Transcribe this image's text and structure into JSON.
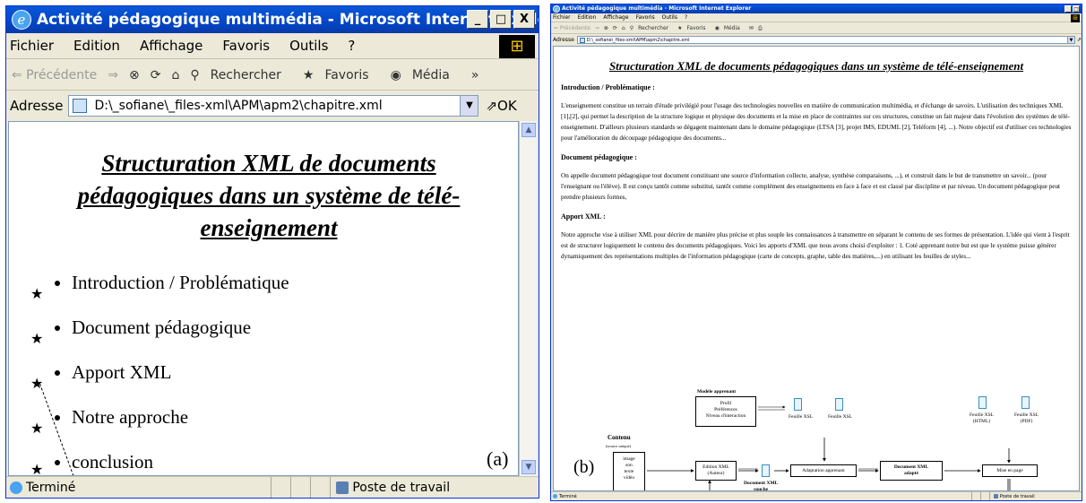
{
  "window": {
    "title": "Activité pédagogique multimédia - Microsoft Internet Explorer",
    "min": "_",
    "max": "□",
    "close": "X"
  },
  "menu": [
    "Fichier",
    "Edition",
    "Affichage",
    "Favoris",
    "Outils",
    "?"
  ],
  "toolbar": {
    "back": "⇐ Précédente",
    "forward": "⇒",
    "search": "Rechercher",
    "favorites": "Favoris",
    "media": "Média",
    "more": "»"
  },
  "address": {
    "label": "Adresse",
    "value_a": "D:\\_sofiane\\_files-xml\\APM\\apm2\\chapitre.xml",
    "value_b": "D:\\_sofiane\\_files-xml\\APM\\apm2\\chapitre.xml",
    "go": "OK"
  },
  "status": {
    "done": "Terminé",
    "zone": "Poste de travail"
  },
  "docA": {
    "title": "Structuration XML de documents pédagogiques dans un système de télé-enseignement",
    "items": [
      "Introduction / Problématique",
      "Document pédagogique",
      "Apport XML",
      "Notre approche",
      "conclusion"
    ],
    "label": "(a)"
  },
  "docB": {
    "title": "Structuration XML de documents pédagogiques dans un système de télé-enseignement",
    "h1": "Introduction / Problématique :",
    "p1": "L'enseignement constitue un terrain d'étude privilégié pour l'usage des technologies nouvelles en matière de communication multimédia, et d'échange de savoirs. L'utilisation des techniques XML [1],[2], qui permet la description de la structure logique et physique des documents et la mise en place de contraintes sur ces structures, constitue un fait majeur dans l'évolution des systèmes de télé-enseignement. D'ailleurs plusieurs standards se dégagent maintenant dans le domaine pédagogique (LTSA [3], projet IMS, EDUML [2], Teléform [4], ...). Notre objectif est d'utiliser ces technologies pour l'amélioration du découpage pédagogique des documents...",
    "h2": "Document pédagogique :",
    "p2": "On appelle document pédagogique tout document constituant une source d'information collecte, analyse, synthèse comparaisons, ...), et construit dans le but de transmettre un savoir... (pour l'enseignant ou l'élève). Il est conçu tantôt comme substitut, tantôt comme complément des enseignements en face à face et est classé par discipline et par niveau. Un document pédagogique peut prendre plusieurs formes,",
    "h3": "Apport XML :",
    "p3": "Notre approche vise à utiliser XML pour décrire de manière plus précise et plus souple les connaissances à transmettre en séparant le contenu de ses formes de présentation. L'idée qui vient à l'esprit est de structurer logiquement le contenu des documents pédagogiques. Voici les apports d'XML que nous avons choisi d'exploiter : 1. Coté apprenant notre but est que le système puisse générer dynamiquement des représentations multiples de l'information pédagogique (carte de concepts, graphe, table des matières,...) en utilisant les feuilles de styles...",
    "diagram": {
      "modele": "Modèle apprenant",
      "modele_items": "Profil\nPréférences\nNiveau d'interaction",
      "contenu": "Contenu",
      "contenu_sub": "(source unique)",
      "media": "image\nson\ntexte\nvidéo",
      "edition": "Edition XML\n(Auteur)",
      "docxml": "Document XML\nsouche",
      "adapt": "Adaptation apprenant",
      "docadapt": "Document XML\nadapté",
      "mise": "Mise en page",
      "xsl1": "Feuille XSL",
      "xsl2": "Feuille XSL",
      "xsl3": "Feuille XSL\n(HTML)",
      "xsl4": "Feuille XSL\n(PDF)"
    },
    "label": "(b)"
  }
}
